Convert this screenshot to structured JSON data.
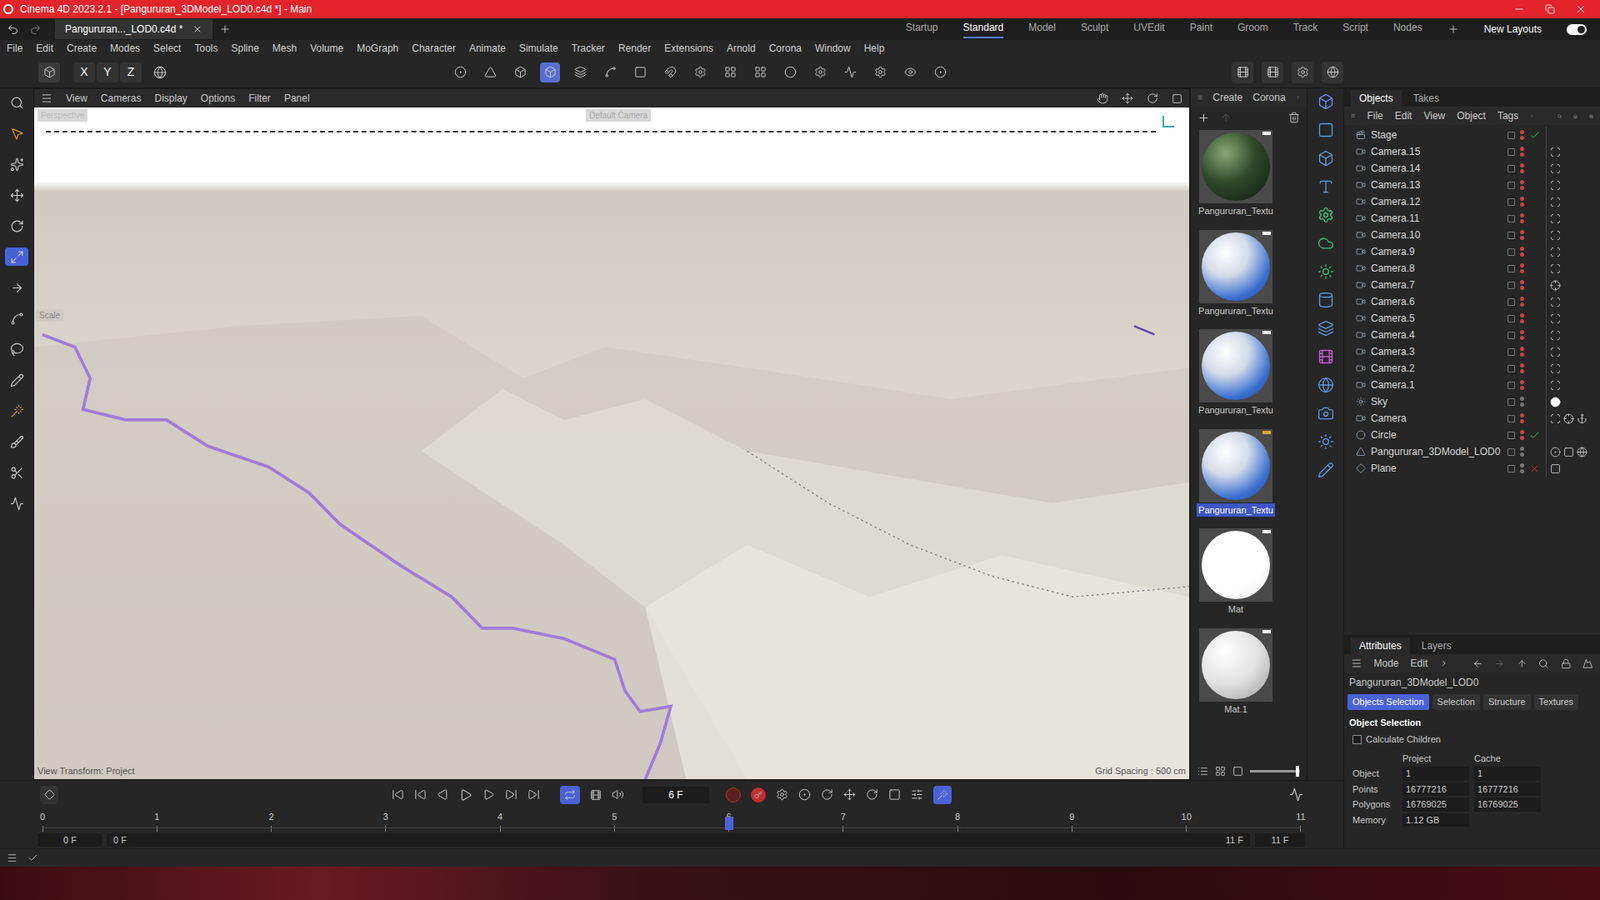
{
  "window": {
    "title": "Cinema 4D 2023.2.1 - [Pangururan_3DModel_LOD0.c4d *] - Main"
  },
  "file_tabs": [
    {
      "label": "Pangururan..._LOD0.c4d *",
      "selected": true
    }
  ],
  "layouts": [
    {
      "label": "Startup",
      "selected": false
    },
    {
      "label": "Standard",
      "selected": true
    },
    {
      "label": "Model",
      "selected": false
    },
    {
      "label": "Sculpt",
      "selected": false
    },
    {
      "label": "UVEdit",
      "selected": false
    },
    {
      "label": "Paint",
      "selected": false
    },
    {
      "label": "Groom",
      "selected": false
    },
    {
      "label": "Track",
      "selected": false
    },
    {
      "label": "Script",
      "selected": false
    },
    {
      "label": "Nodes",
      "selected": false
    }
  ],
  "new_layouts": {
    "label": "New Layouts",
    "on": true
  },
  "menu": [
    "File",
    "Edit",
    "Create",
    "Modes",
    "Select",
    "Tools",
    "Spline",
    "Mesh",
    "Volume",
    "MoGraph",
    "Character",
    "Animate",
    "Simulate",
    "Tracker",
    "Render",
    "Extensions",
    "Arnold",
    "Corona",
    "Window",
    "Help"
  ],
  "toolbar": {
    "axes": [
      "X",
      "Y",
      "Z"
    ]
  },
  "viewport": {
    "menu": [
      "View",
      "Cameras",
      "Display",
      "Options",
      "Filter",
      "Panel"
    ],
    "camera_label": "Perspective",
    "camera_name": "Default Camera",
    "hud_label": "Scale",
    "view_transform": "View Transform: Project",
    "grid_spacing": "Grid Spacing : 500 cm"
  },
  "materials": {
    "menu": [
      "Create",
      "Corona"
    ],
    "items": [
      {
        "name": "Pangururan_Textu",
        "kind": "moss",
        "selected": false
      },
      {
        "name": "Pangururan_Textu",
        "kind": "water",
        "selected": false
      },
      {
        "name": "Pangururan_Textu",
        "kind": "water",
        "selected": false
      },
      {
        "name": "Pangururan_Textu",
        "kind": "water",
        "selected": true
      },
      {
        "name": "Mat",
        "kind": "white",
        "selected": false
      },
      {
        "name": "Mat.1",
        "kind": "matte",
        "selected": false
      }
    ],
    "size_slider": {
      "level": 0.95
    }
  },
  "objects": {
    "tabs": [
      {
        "label": "Objects",
        "selected": true
      },
      {
        "label": "Takes",
        "selected": false
      }
    ],
    "menu": [
      "File",
      "Edit",
      "View",
      "Object",
      "Tags"
    ],
    "items": [
      {
        "name": "Stage",
        "kind": "stage",
        "hidden": true,
        "status": "check",
        "tags": []
      },
      {
        "name": "Camera.15",
        "kind": "camera",
        "hidden": true,
        "status": "none",
        "tags": [
          "protection"
        ]
      },
      {
        "name": "Camera.14",
        "kind": "camera",
        "hidden": true,
        "status": "none",
        "tags": [
          "protection"
        ]
      },
      {
        "name": "Camera.13",
        "kind": "camera",
        "hidden": true,
        "status": "none",
        "tags": [
          "protection"
        ]
      },
      {
        "name": "Camera.12",
        "kind": "camera",
        "hidden": true,
        "status": "none",
        "tags": [
          "protection"
        ]
      },
      {
        "name": "Camera.11",
        "kind": "camera",
        "hidden": true,
        "status": "none",
        "tags": [
          "protection"
        ]
      },
      {
        "name": "Camera.10",
        "kind": "camera",
        "hidden": true,
        "status": "none",
        "tags": [
          "protection"
        ]
      },
      {
        "name": "Camera.9",
        "kind": "camera",
        "hidden": true,
        "status": "none",
        "tags": [
          "protection"
        ]
      },
      {
        "name": "Camera.8",
        "kind": "camera",
        "hidden": true,
        "status": "none",
        "tags": [
          "protection"
        ]
      },
      {
        "name": "Camera.7",
        "kind": "camera",
        "hidden": true,
        "status": "none",
        "tags": [
          "target"
        ]
      },
      {
        "name": "Camera.6",
        "kind": "camera",
        "hidden": true,
        "status": "none",
        "tags": [
          "protection"
        ]
      },
      {
        "name": "Camera.5",
        "kind": "camera",
        "hidden": true,
        "status": "none",
        "tags": [
          "protection"
        ]
      },
      {
        "name": "Camera.4",
        "kind": "camera",
        "hidden": true,
        "status": "none",
        "tags": [
          "protection"
        ]
      },
      {
        "name": "Camera.3",
        "kind": "camera",
        "hidden": true,
        "status": "none",
        "tags": [
          "protection"
        ]
      },
      {
        "name": "Camera.2",
        "kind": "camera",
        "hidden": true,
        "status": "none",
        "tags": [
          "protection"
        ]
      },
      {
        "name": "Camera.1",
        "kind": "camera",
        "hidden": true,
        "status": "none",
        "tags": [
          "protection"
        ]
      },
      {
        "name": "Sky",
        "kind": "sky",
        "hidden": false,
        "status": "none",
        "tags": [
          "white"
        ]
      },
      {
        "name": "Camera",
        "kind": "camera",
        "hidden": true,
        "status": "none",
        "tags": [
          "protection",
          "target",
          "axis"
        ]
      },
      {
        "name": "Circle",
        "kind": "circle",
        "hidden": true,
        "status": "check",
        "tags": []
      },
      {
        "name": "Pangururan_3DModel_LOD0",
        "kind": "model",
        "hidden": false,
        "status": "none",
        "tags": [
          "phong",
          "uvw",
          "texture"
        ]
      },
      {
        "name": "Plane",
        "kind": "plane",
        "hidden": false,
        "status": "cross",
        "tags": [
          "uvw"
        ]
      }
    ]
  },
  "attributes": {
    "tabs": [
      {
        "label": "Attributes",
        "selected": true
      },
      {
        "label": "Layers",
        "selected": false
      }
    ],
    "menu": [
      "Mode",
      "Edit"
    ],
    "object_name": "Pangururan_3DModel_LOD0",
    "sections": [
      {
        "label": "Objects Selection",
        "selected": true
      },
      {
        "label": "Selection",
        "selected": false
      },
      {
        "label": "Structure",
        "selected": false
      },
      {
        "label": "Textures",
        "selected": false
      }
    ],
    "heading": "Object Selection",
    "calculate_children": {
      "label": "Calculate Children",
      "checked": false
    },
    "columns": [
      "Project",
      "Cache"
    ],
    "rows": [
      {
        "label": "Object",
        "values": [
          "1",
          "1"
        ]
      },
      {
        "label": "Points",
        "values": [
          "16777216",
          "16777216"
        ]
      },
      {
        "label": "Polygons",
        "values": [
          "16769025",
          "16769025"
        ]
      },
      {
        "label": "Memory",
        "values": [
          "1.12 GB"
        ]
      }
    ]
  },
  "timeline": {
    "current_frame": "6 F",
    "ticks": [
      "0",
      "1",
      "2",
      "3",
      "4",
      "5",
      "6",
      "7",
      "8",
      "9",
      "10",
      "11"
    ],
    "playhead_level": 0.5455,
    "range_start": "0 F",
    "range_start_inner": "0 F",
    "range_end_inner": "11 F",
    "range_end": "11 F"
  }
}
